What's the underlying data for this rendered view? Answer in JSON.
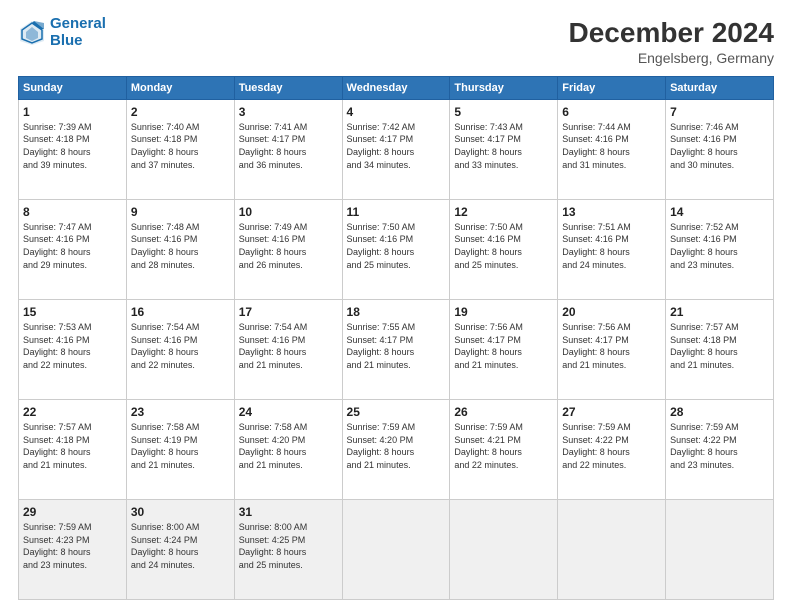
{
  "logo": {
    "line1": "General",
    "line2": "Blue"
  },
  "title": "December 2024",
  "subtitle": "Engelsberg, Germany",
  "days_header": [
    "Sunday",
    "Monday",
    "Tuesday",
    "Wednesday",
    "Thursday",
    "Friday",
    "Saturday"
  ],
  "weeks": [
    [
      {
        "day": "1",
        "info": "Sunrise: 7:39 AM\nSunset: 4:18 PM\nDaylight: 8 hours\nand 39 minutes."
      },
      {
        "day": "2",
        "info": "Sunrise: 7:40 AM\nSunset: 4:18 PM\nDaylight: 8 hours\nand 37 minutes."
      },
      {
        "day": "3",
        "info": "Sunrise: 7:41 AM\nSunset: 4:17 PM\nDaylight: 8 hours\nand 36 minutes."
      },
      {
        "day": "4",
        "info": "Sunrise: 7:42 AM\nSunset: 4:17 PM\nDaylight: 8 hours\nand 34 minutes."
      },
      {
        "day": "5",
        "info": "Sunrise: 7:43 AM\nSunset: 4:17 PM\nDaylight: 8 hours\nand 33 minutes."
      },
      {
        "day": "6",
        "info": "Sunrise: 7:44 AM\nSunset: 4:16 PM\nDaylight: 8 hours\nand 31 minutes."
      },
      {
        "day": "7",
        "info": "Sunrise: 7:46 AM\nSunset: 4:16 PM\nDaylight: 8 hours\nand 30 minutes."
      }
    ],
    [
      {
        "day": "8",
        "info": "Sunrise: 7:47 AM\nSunset: 4:16 PM\nDaylight: 8 hours\nand 29 minutes."
      },
      {
        "day": "9",
        "info": "Sunrise: 7:48 AM\nSunset: 4:16 PM\nDaylight: 8 hours\nand 28 minutes."
      },
      {
        "day": "10",
        "info": "Sunrise: 7:49 AM\nSunset: 4:16 PM\nDaylight: 8 hours\nand 26 minutes."
      },
      {
        "day": "11",
        "info": "Sunrise: 7:50 AM\nSunset: 4:16 PM\nDaylight: 8 hours\nand 25 minutes."
      },
      {
        "day": "12",
        "info": "Sunrise: 7:50 AM\nSunset: 4:16 PM\nDaylight: 8 hours\nand 25 minutes."
      },
      {
        "day": "13",
        "info": "Sunrise: 7:51 AM\nSunset: 4:16 PM\nDaylight: 8 hours\nand 24 minutes."
      },
      {
        "day": "14",
        "info": "Sunrise: 7:52 AM\nSunset: 4:16 PM\nDaylight: 8 hours\nand 23 minutes."
      }
    ],
    [
      {
        "day": "15",
        "info": "Sunrise: 7:53 AM\nSunset: 4:16 PM\nDaylight: 8 hours\nand 22 minutes."
      },
      {
        "day": "16",
        "info": "Sunrise: 7:54 AM\nSunset: 4:16 PM\nDaylight: 8 hours\nand 22 minutes."
      },
      {
        "day": "17",
        "info": "Sunrise: 7:54 AM\nSunset: 4:16 PM\nDaylight: 8 hours\nand 21 minutes."
      },
      {
        "day": "18",
        "info": "Sunrise: 7:55 AM\nSunset: 4:17 PM\nDaylight: 8 hours\nand 21 minutes."
      },
      {
        "day": "19",
        "info": "Sunrise: 7:56 AM\nSunset: 4:17 PM\nDaylight: 8 hours\nand 21 minutes."
      },
      {
        "day": "20",
        "info": "Sunrise: 7:56 AM\nSunset: 4:17 PM\nDaylight: 8 hours\nand 21 minutes."
      },
      {
        "day": "21",
        "info": "Sunrise: 7:57 AM\nSunset: 4:18 PM\nDaylight: 8 hours\nand 21 minutes."
      }
    ],
    [
      {
        "day": "22",
        "info": "Sunrise: 7:57 AM\nSunset: 4:18 PM\nDaylight: 8 hours\nand 21 minutes."
      },
      {
        "day": "23",
        "info": "Sunrise: 7:58 AM\nSunset: 4:19 PM\nDaylight: 8 hours\nand 21 minutes."
      },
      {
        "day": "24",
        "info": "Sunrise: 7:58 AM\nSunset: 4:20 PM\nDaylight: 8 hours\nand 21 minutes."
      },
      {
        "day": "25",
        "info": "Sunrise: 7:59 AM\nSunset: 4:20 PM\nDaylight: 8 hours\nand 21 minutes."
      },
      {
        "day": "26",
        "info": "Sunrise: 7:59 AM\nSunset: 4:21 PM\nDaylight: 8 hours\nand 22 minutes."
      },
      {
        "day": "27",
        "info": "Sunrise: 7:59 AM\nSunset: 4:22 PM\nDaylight: 8 hours\nand 22 minutes."
      },
      {
        "day": "28",
        "info": "Sunrise: 7:59 AM\nSunset: 4:22 PM\nDaylight: 8 hours\nand 23 minutes."
      }
    ],
    [
      {
        "day": "29",
        "info": "Sunrise: 7:59 AM\nSunset: 4:23 PM\nDaylight: 8 hours\nand 23 minutes."
      },
      {
        "day": "30",
        "info": "Sunrise: 8:00 AM\nSunset: 4:24 PM\nDaylight: 8 hours\nand 24 minutes."
      },
      {
        "day": "31",
        "info": "Sunrise: 8:00 AM\nSunset: 4:25 PM\nDaylight: 8 hours\nand 25 minutes."
      },
      {
        "day": "",
        "info": ""
      },
      {
        "day": "",
        "info": ""
      },
      {
        "day": "",
        "info": ""
      },
      {
        "day": "",
        "info": ""
      }
    ]
  ]
}
